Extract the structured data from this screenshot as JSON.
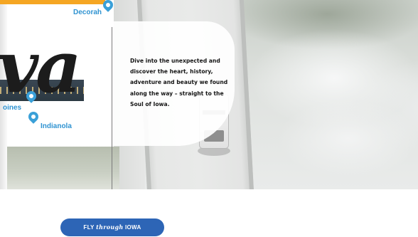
{
  "map": {
    "big_word": "va",
    "cities": [
      {
        "label": "Decorah"
      },
      {
        "label": "oines"
      },
      {
        "label": "Indianola"
      }
    ]
  },
  "copy": {
    "text": "Dive into the unexpected and discover the heart, history, adventure and beauty we found along the way – straight to the Soul of Iowa."
  },
  "cta": {
    "prefix": "FLY",
    "script": "through",
    "suffix": "IOWA"
  },
  "colors": {
    "accent_orange": "#f5a623",
    "pin_blue": "#3aa0d8",
    "city_blue": "#2f93d1",
    "button_blue": "#2d65b6"
  },
  "icons": {
    "map_pin": "map-pin-icon"
  }
}
